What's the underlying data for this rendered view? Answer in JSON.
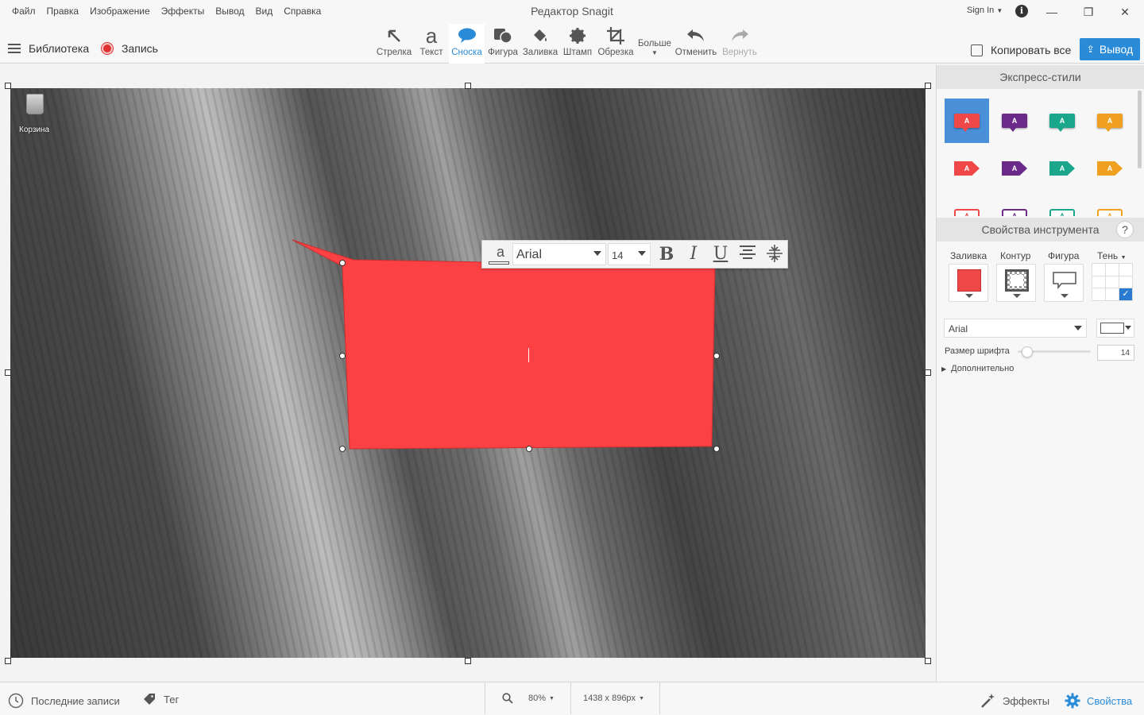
{
  "window": {
    "title": "Редактор Snagit",
    "sign_in": "Sign In",
    "minimize": "—",
    "maximize": "❐",
    "close": "✕"
  },
  "menu": [
    "Файл",
    "Правка",
    "Изображение",
    "Эффекты",
    "Вывод",
    "Вид",
    "Справка"
  ],
  "toolbar": {
    "library": "Библиотека",
    "record": "Запись",
    "tools": [
      {
        "label": "Стрелка",
        "icon": "arrow-icon"
      },
      {
        "label": "Текст",
        "icon": "text-icon"
      },
      {
        "label": "Сноска",
        "icon": "callout-icon"
      },
      {
        "label": "Фигура",
        "icon": "shape-icon"
      },
      {
        "label": "Заливка",
        "icon": "fill-icon"
      },
      {
        "label": "Штамп",
        "icon": "stamp-icon"
      },
      {
        "label": "Обрезка",
        "icon": "crop-icon"
      }
    ],
    "more": "Больше",
    "undo": "Отменить",
    "redo": "Вернуть",
    "copy_all": "Копировать все",
    "output": "Вывод",
    "active_tool": "Сноска",
    "accent_color": "#2a8bd8"
  },
  "canvas": {
    "desktop_icon_label": "Корзина",
    "callout_fill": "#fc4145"
  },
  "font_toolbar": {
    "font": "Arial",
    "size": "14",
    "bold": "B",
    "italic": "I",
    "underline": "U"
  },
  "panel": {
    "quick_styles_title": "Экспресс-стили",
    "style_colors": [
      "#f04848",
      "#6a2a8a",
      "#1aa68a",
      "#f0a020"
    ],
    "tool_props_title": "Свойства инструмента",
    "help": "?",
    "fill_label": "Заливка",
    "outline_label": "Контур",
    "shape_label": "Фигура",
    "shadow_label": "Тень",
    "fill_color": "#f04848",
    "font": "Arial",
    "font_size_label": "Размер шрифта",
    "font_size": "14",
    "advanced": "Дополнительно"
  },
  "statusbar": {
    "recent": "Последние записи",
    "tag": "Тег",
    "zoom": "80%",
    "dimensions": "1438 x 896px",
    "effects": "Эффекты",
    "properties": "Свойства"
  }
}
